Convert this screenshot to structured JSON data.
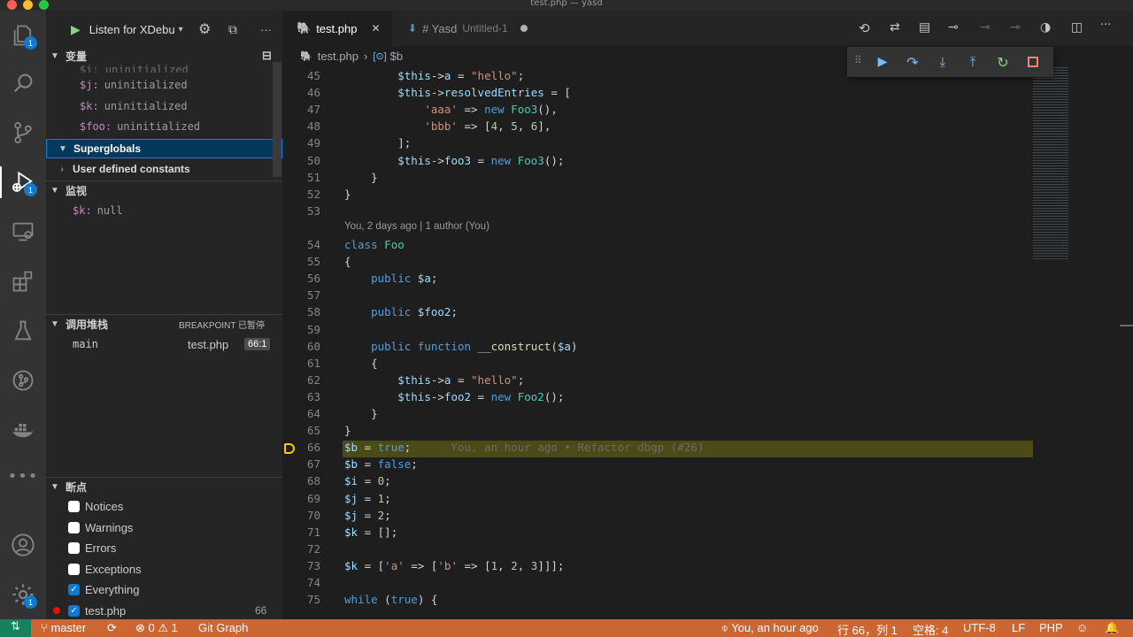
{
  "window": {
    "title": "test.php — yasd"
  },
  "colors": {
    "statusbar": "#cc6633",
    "accent": "#0e7ad3",
    "current_line": "#4b4b18"
  },
  "activity": {
    "explorer_badge": "1",
    "debug_badge": "1",
    "settings_badge": "1"
  },
  "debug_header": {
    "config_name": "Listen for XDebu"
  },
  "variables": {
    "title": "变量",
    "partial_top": "$i: uninitialized",
    "items": [
      {
        "name": "$j:",
        "value": "uninitialized"
      },
      {
        "name": "$k:",
        "value": "uninitialized"
      },
      {
        "name": "$foo:",
        "value": "uninitialized"
      }
    ],
    "groups": [
      "Superglobals",
      "User defined constants"
    ]
  },
  "watch": {
    "title": "监视",
    "items": [
      {
        "name": "$k:",
        "value": "null"
      }
    ]
  },
  "callstack": {
    "title": "调用堆栈",
    "status": "BREAKPOINT 已暂停",
    "frames": [
      {
        "name": "main",
        "file": "test.php",
        "pos": "66:1"
      }
    ]
  },
  "breakpoints": {
    "title": "断点",
    "items": [
      {
        "label": "Notices",
        "checked": false
      },
      {
        "label": "Warnings",
        "checked": false
      },
      {
        "label": "Errors",
        "checked": false
      },
      {
        "label": "Exceptions",
        "checked": false
      },
      {
        "label": "Everything",
        "checked": true
      },
      {
        "label": "test.php",
        "checked": true,
        "line": "66"
      }
    ]
  },
  "tabs": [
    {
      "label": "test.php",
      "close": "✕"
    },
    {
      "label": "# Yasd",
      "extra": "Untitled-1"
    }
  ],
  "breadcrumb": {
    "file": "test.php",
    "symbol": "$b"
  },
  "codelens": "You, 2 days ago | 1 author (You)",
  "blame_inline": "You, an hour ago • Refactor dbgp (#26)",
  "code_lines": [
    {
      "n": "45",
      "html": "        <span class='vr'>$this</span>-><span class='vr'>a</span> = <span class='st'>\"hello\"</span>;"
    },
    {
      "n": "46",
      "html": "        <span class='vr'>$this</span>-><span class='vr'>resolvedEntries</span> = ["
    },
    {
      "n": "47",
      "html": "            <span class='st'>'aaa'</span> => <span class='kw'>new</span> <span class='ty'>Foo3</span>(),"
    },
    {
      "n": "48",
      "html": "            <span class='st'>'bbb'</span> => [<span class='nm'>4</span>, <span class='nm'>5</span>, <span class='nm'>6</span>],"
    },
    {
      "n": "49",
      "html": "        ];"
    },
    {
      "n": "50",
      "html": "        <span class='vr'>$this</span>-><span class='vr'>foo3</span> = <span class='kw'>new</span> <span class='ty'>Foo3</span>();"
    },
    {
      "n": "51",
      "html": "    }"
    },
    {
      "n": "52",
      "html": "}"
    },
    {
      "n": "53",
      "html": ""
    },
    {
      "n": "54",
      "html": "<span class='kw'>class</span> <span class='ty'>Foo</span>"
    },
    {
      "n": "55",
      "html": "{"
    },
    {
      "n": "56",
      "html": "    <span class='kw'>public</span> <span class='vr'>$a</span>;"
    },
    {
      "n": "57",
      "html": ""
    },
    {
      "n": "58",
      "html": "    <span class='kw'>public</span> <span class='vr'>$foo2</span>;"
    },
    {
      "n": "59",
      "html": ""
    },
    {
      "n": "60",
      "html": "    <span class='kw'>public</span> <span class='kw'>function</span> <span class='fn'>__construct</span>(<span class='vr'>$a</span>)"
    },
    {
      "n": "61",
      "html": "    {"
    },
    {
      "n": "62",
      "html": "        <span class='vr'>$this</span>-><span class='vr'>a</span> = <span class='st'>\"hello\"</span>;"
    },
    {
      "n": "63",
      "html": "        <span class='vr'>$this</span>-><span class='vr'>foo2</span> = <span class='kw'>new</span> <span class='ty'>Foo2</span>();"
    },
    {
      "n": "64",
      "html": "    }"
    },
    {
      "n": "65",
      "html": "}"
    },
    {
      "n": "66",
      "html": "<span class='vr'>$b</span> = <span class='kw'>true</span>;"
    },
    {
      "n": "67",
      "html": "<span class='vr'>$b</span> = <span class='kw'>false</span>;"
    },
    {
      "n": "68",
      "html": "<span class='vr'>$i</span> = <span class='nm'>0</span>;"
    },
    {
      "n": "69",
      "html": "<span class='vr'>$j</span> = <span class='nm'>1</span>;"
    },
    {
      "n": "70",
      "html": "<span class='vr'>$j</span> = <span class='nm'>2</span>;"
    },
    {
      "n": "71",
      "html": "<span class='vr'>$k</span> = [];"
    },
    {
      "n": "72",
      "html": ""
    },
    {
      "n": "73",
      "html": "<span class='vr'>$k</span> = [<span class='st'>'a'</span> => [<span class='st'>'b'</span> => [<span class='nm'>1</span>, <span class='nm'>2</span>, <span class='nm'>3</span>]]];"
    },
    {
      "n": "74",
      "html": ""
    },
    {
      "n": "75",
      "html": "<span class='kw'>while</span> (<span class='kw'>true</span>) {"
    }
  ],
  "status": {
    "branch": "master",
    "problems": "0",
    "warnings": "1",
    "git_graph": "Git Graph",
    "blame": "You, an hour ago",
    "cursor": "行 66，列 1",
    "spaces": "空格: 4",
    "encoding": "UTF-8",
    "eol": "LF",
    "language": "PHP"
  }
}
